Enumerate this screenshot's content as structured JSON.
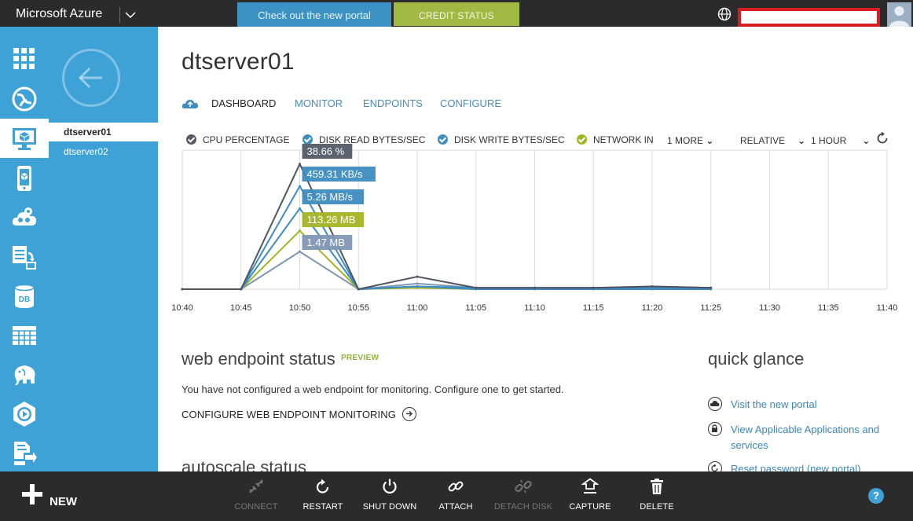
{
  "topbar": {
    "brand": "Microsoft Azure",
    "portal_link": "Check out the new portal",
    "credit_status": "CREDIT STATUS"
  },
  "resources": [
    "dtserver01",
    "dtserver02"
  ],
  "page": {
    "title": "dtserver01",
    "tabs": [
      "DASHBOARD",
      "MONITOR",
      "ENDPOINTS",
      "CONFIGURE"
    ]
  },
  "legend": {
    "metrics": [
      {
        "label": "CPU PERCENTAGE",
        "color": "#555a66"
      },
      {
        "label": "DISK READ BYTES/SEC",
        "color": "#3d8fbf"
      },
      {
        "label": "DISK WRITE BYTES/SEC",
        "color": "#3d8fbf"
      },
      {
        "label": "NETWORK IN",
        "color": "#a3b524"
      }
    ],
    "more": "1 MORE",
    "scale": "RELATIVE",
    "range": "1 HOUR"
  },
  "chart_data": {
    "type": "line",
    "x": [
      "10:40",
      "10:45",
      "10:50",
      "10:55",
      "11:00",
      "11:05",
      "11:10",
      "11:15",
      "11:20",
      "11:25",
      "11:30",
      "11:35",
      "11:40"
    ],
    "relative_scale": true,
    "series": [
      {
        "name": "CPU PERCENTAGE",
        "color": "#4f5361",
        "values": [
          0,
          0,
          0.9,
          0,
          0.09,
          0.01,
          0.01,
          0.01,
          0.02,
          0.01
        ]
      },
      {
        "name": "DISK READ BYTES/SEC",
        "color": "#3e8cc0",
        "values": [
          0,
          0,
          0.74,
          0,
          0.02,
          0.01,
          0.01,
          0.01,
          0.01,
          0.01
        ]
      },
      {
        "name": "DISK WRITE BYTES/SEC",
        "color": "#3e8cc0",
        "values": [
          0,
          0,
          0.58,
          0,
          0.02,
          0,
          0,
          0,
          0,
          0
        ]
      },
      {
        "name": "NETWORK IN",
        "color": "#a3b524",
        "values": [
          0,
          0,
          0.42,
          0,
          0.01,
          0,
          0,
          0,
          0,
          0
        ]
      },
      {
        "name": "",
        "color": "#7f97b5",
        "values": [
          0,
          0,
          0.27,
          0,
          0.04,
          0.01,
          0.01,
          0.01,
          0.02,
          0.01
        ]
      }
    ],
    "tooltips": [
      {
        "text": "38.66 %",
        "color": "#555a66"
      },
      {
        "text": "459.31 KB/s",
        "color": "#3e8cc0"
      },
      {
        "text": "5.26 MB/s",
        "color": "#3e8cc0"
      },
      {
        "text": "113.26 MB",
        "color": "#a3b524"
      },
      {
        "text": "1.47 MB",
        "color": "#7f97b5"
      }
    ]
  },
  "endpoint": {
    "title": "web endpoint status",
    "badge": "PREVIEW",
    "message": "You have not configured a web endpoint for monitoring. Configure one to get started.",
    "action": "CONFIGURE WEB ENDPOINT MONITORING"
  },
  "autoscale": {
    "title": "autoscale status"
  },
  "quick_glance": {
    "title": "quick glance",
    "links": [
      {
        "icon": "cloud-icon",
        "text": "Visit the new portal"
      },
      {
        "icon": "lock-icon",
        "text": "View Applicable Applications and services"
      },
      {
        "icon": "reset-icon",
        "text": "Reset password (new portal)"
      }
    ]
  },
  "commands": {
    "new": "NEW",
    "items": [
      {
        "label": "CONNECT",
        "enabled": false
      },
      {
        "label": "RESTART",
        "enabled": true
      },
      {
        "label": "SHUT DOWN",
        "enabled": true
      },
      {
        "label": "ATTACH",
        "enabled": true
      },
      {
        "label": "DETACH DISK",
        "enabled": false
      },
      {
        "label": "CAPTURE",
        "enabled": true
      },
      {
        "label": "DELETE",
        "enabled": true
      }
    ],
    "help": "?"
  }
}
